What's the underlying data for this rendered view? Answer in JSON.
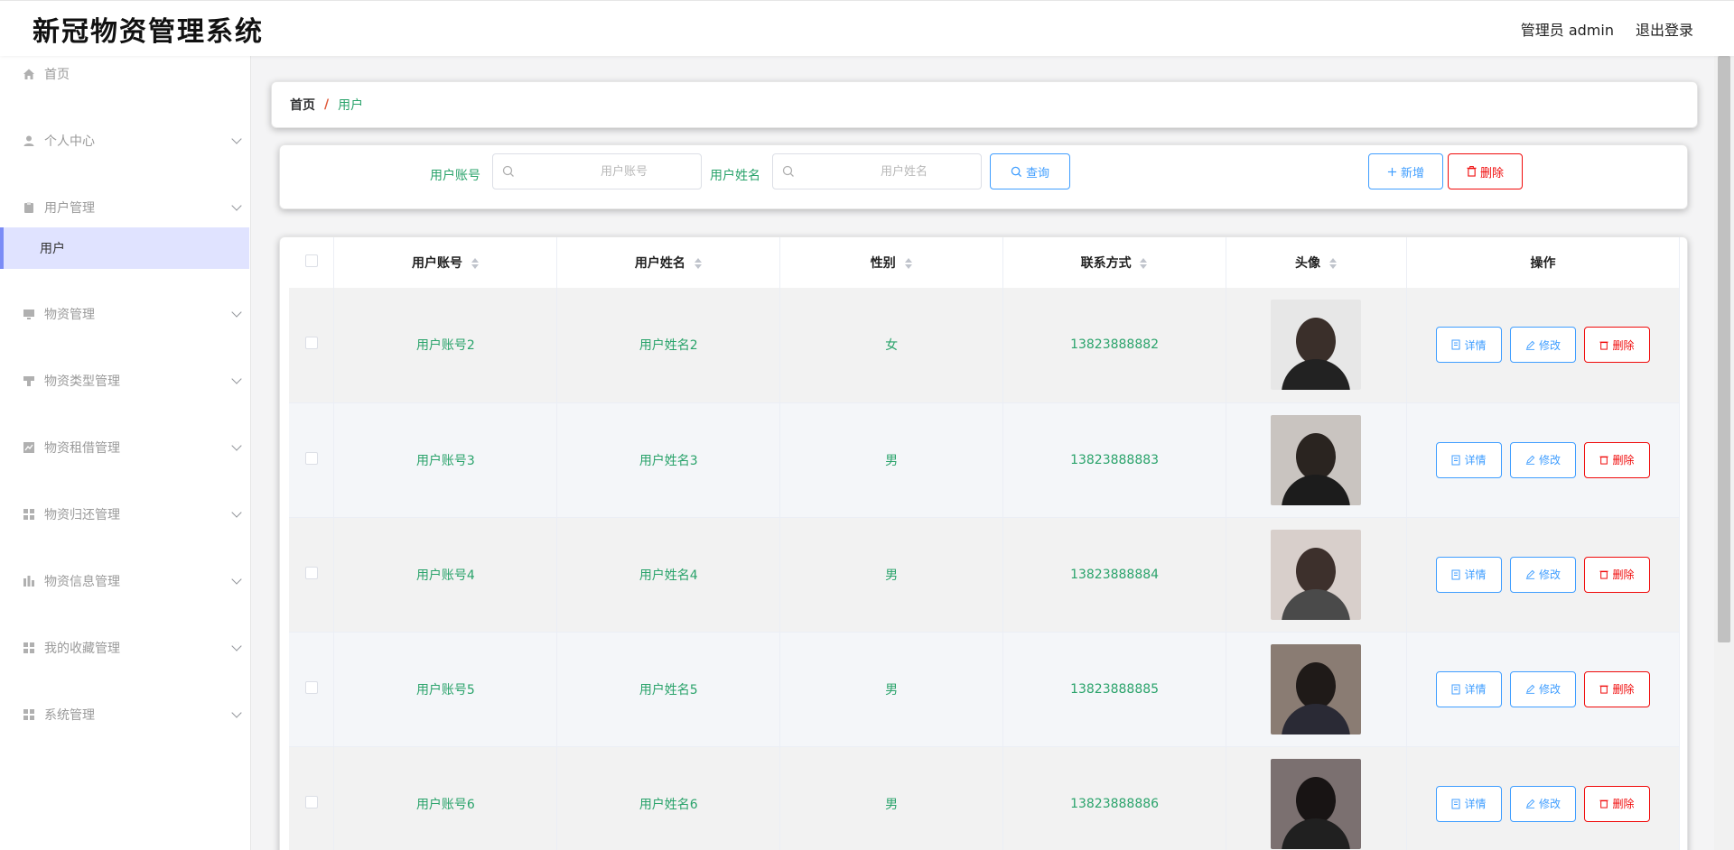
{
  "header": {
    "app_title": "新冠物资管理系统",
    "admin_label": "管理员 admin",
    "logout_label": "退出登录"
  },
  "sidebar": {
    "items": [
      {
        "label": "首页",
        "icon": "home-icon",
        "expandable": false
      },
      {
        "label": "个人中心",
        "icon": "user-icon",
        "expandable": true
      },
      {
        "label": "用户管理",
        "icon": "clipboard-icon",
        "expandable": true
      },
      {
        "label": "用户",
        "icon": "",
        "expandable": false,
        "active": true
      },
      {
        "label": "物资管理",
        "icon": "monitor-icon",
        "expandable": true
      },
      {
        "label": "物资类型管理",
        "icon": "stamp-icon",
        "expandable": true
      },
      {
        "label": "物资租借管理",
        "icon": "chart-icon",
        "expandable": true
      },
      {
        "label": "物资归还管理",
        "icon": "grid-icon",
        "expandable": true
      },
      {
        "label": "物资信息管理",
        "icon": "bar-chart-icon",
        "expandable": true
      },
      {
        "label": "我的收藏管理",
        "icon": "grid-icon",
        "expandable": true
      },
      {
        "label": "系统管理",
        "icon": "grid-icon",
        "expandable": true
      }
    ]
  },
  "breadcrumb": {
    "home": "首页",
    "separator": "/",
    "current": "用户"
  },
  "search": {
    "account_label": "用户账号",
    "account_placeholder": "用户账号",
    "name_label": "用户姓名",
    "name_placeholder": "用户姓名",
    "query_button": "查询",
    "add_button": "新增",
    "delete_button": "删除"
  },
  "table": {
    "columns": [
      "用户账号",
      "用户姓名",
      "性别",
      "联系方式",
      "头像",
      "操作"
    ],
    "rows": [
      {
        "account": "用户账号2",
        "name": "用户姓名2",
        "gender": "女",
        "phone": "13823888882"
      },
      {
        "account": "用户账号3",
        "name": "用户姓名3",
        "gender": "男",
        "phone": "13823888883"
      },
      {
        "account": "用户账号4",
        "name": "用户姓名4",
        "gender": "男",
        "phone": "13823888884"
      },
      {
        "account": "用户账号5",
        "name": "用户姓名5",
        "gender": "男",
        "phone": "13823888885"
      },
      {
        "account": "用户账号6",
        "name": "用户姓名6",
        "gender": "男",
        "phone": "13823888886"
      }
    ],
    "row_actions": {
      "detail": "详情",
      "edit": "修改",
      "delete": "删除"
    }
  },
  "colors": {
    "accent_green": "#2aa36b",
    "primary_blue": "#409eff",
    "danger_red": "#f00a0a",
    "active_menu_bg": "#e0e3ff"
  }
}
